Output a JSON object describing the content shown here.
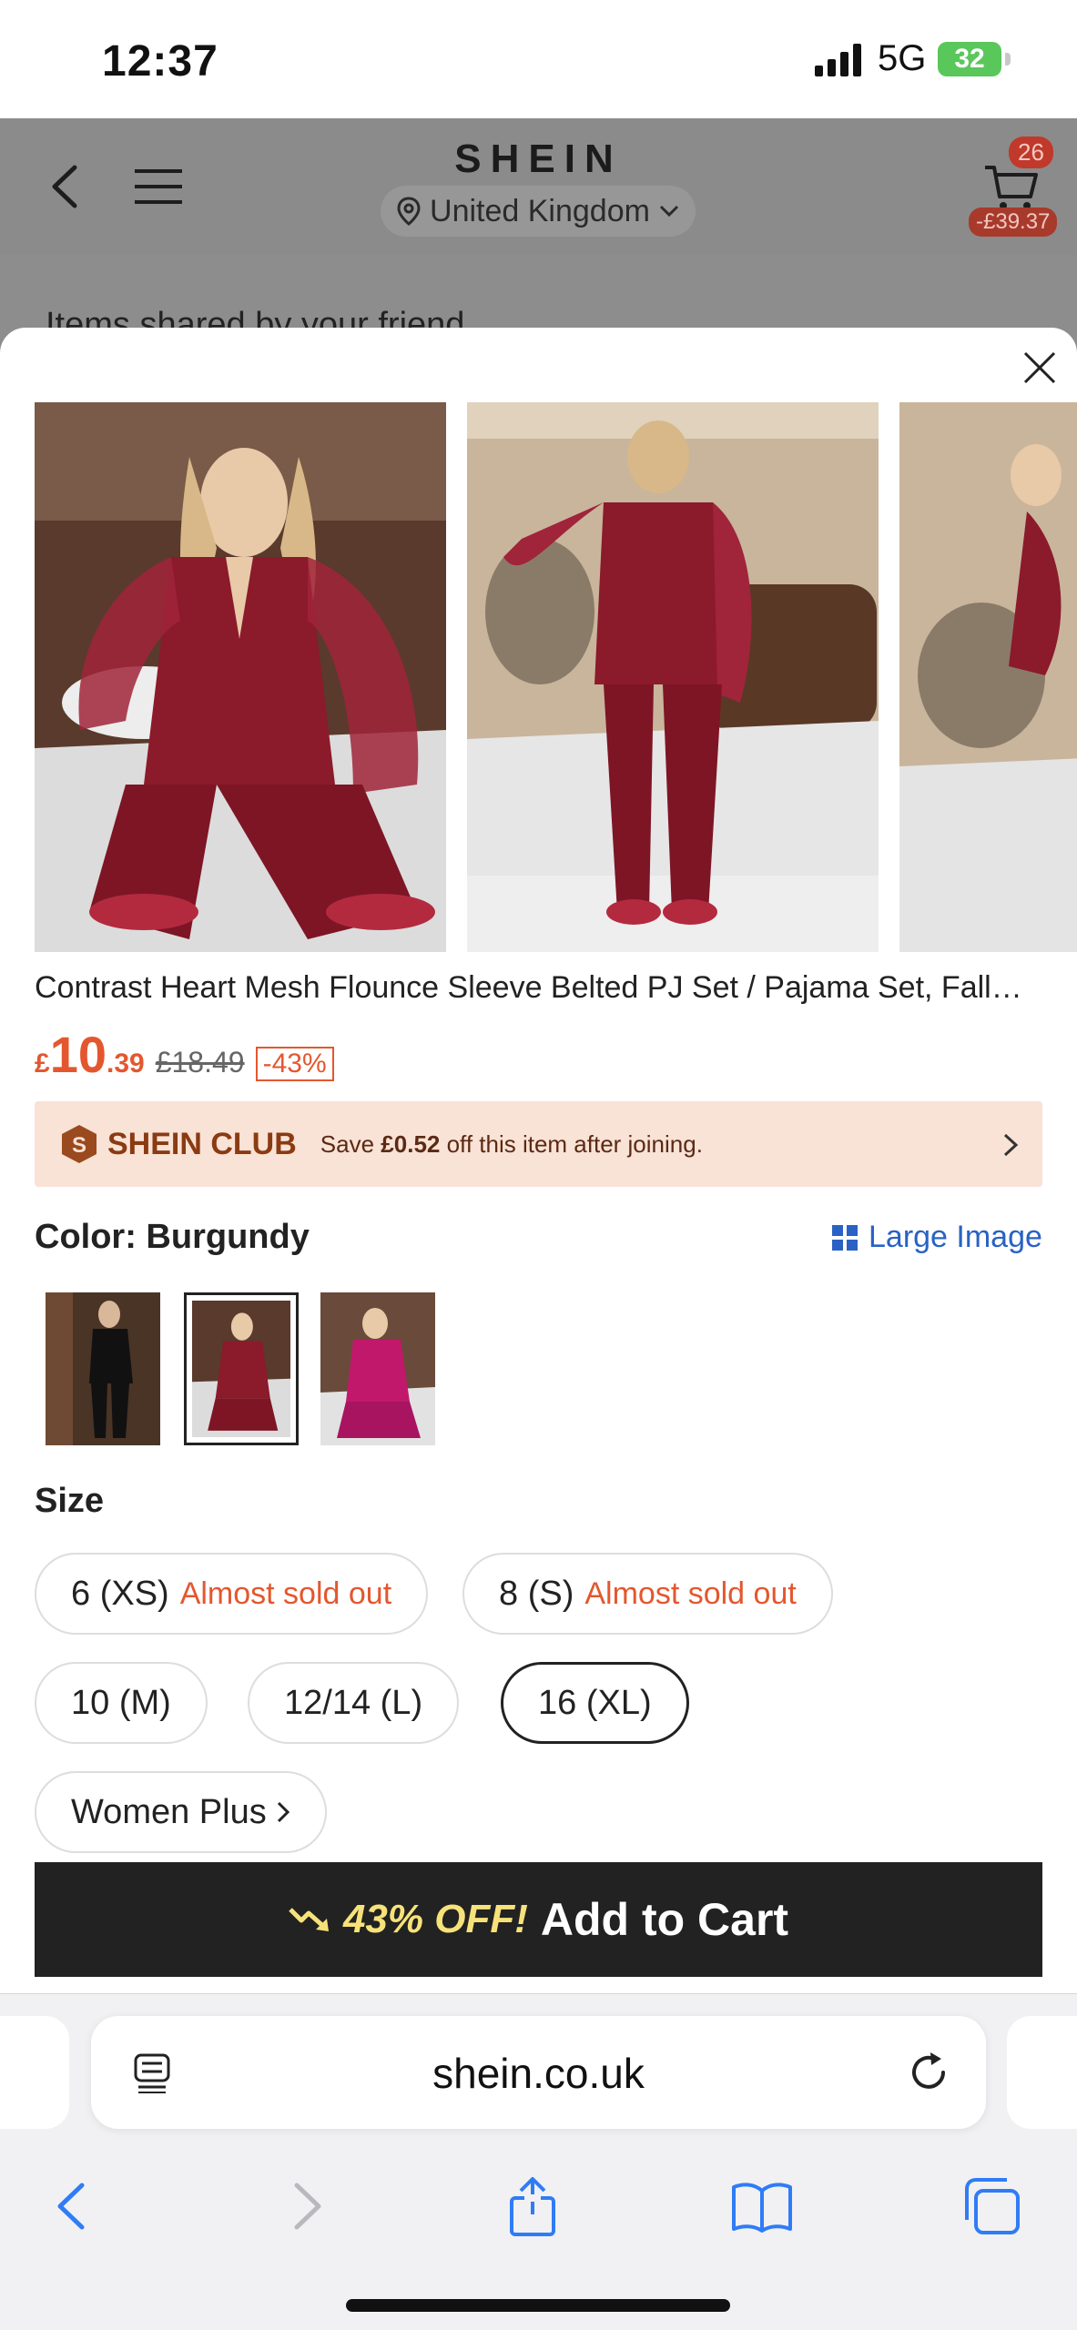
{
  "status_bar": {
    "time": "12:37",
    "network": "5G",
    "battery": "32"
  },
  "site_header": {
    "logo": "SHEIN",
    "region": "United Kingdom",
    "cart_count": "26",
    "cart_total": "-£39.37"
  },
  "background_text": "Items shared by your friend",
  "product": {
    "title": "Contrast Heart Mesh Flounce Sleeve Belted PJ Set / Pajama Set, Fall…",
    "price_currency": "£",
    "price_main": "10",
    "price_decimal": ".39",
    "original_price": "£18.49",
    "discount": "-43%"
  },
  "club": {
    "name": "SHEIN CLUB",
    "save_prefix": "Save ",
    "save_amount": "£0.52",
    "save_suffix": " off this item after joining."
  },
  "color": {
    "label": "Color: Burgundy",
    "large_image": "Large Image",
    "swatches": [
      "Black",
      "Burgundy",
      "Hot Pink"
    ],
    "selected": "Burgundy"
  },
  "size": {
    "label": "Size",
    "options": [
      {
        "label": "6 (XS)",
        "note": "Almost sold out"
      },
      {
        "label": "8 (S)",
        "note": "Almost sold out"
      },
      {
        "label": "10 (M)",
        "note": ""
      },
      {
        "label": "12/14 (L)",
        "note": ""
      },
      {
        "label": "16 (XL)",
        "note": ""
      }
    ],
    "selected": "16 (XL)",
    "women_plus": "Women Plus"
  },
  "cart_button": {
    "discount": "43% OFF!",
    "label": "Add to Cart"
  },
  "browser": {
    "url": "shein.co.uk"
  },
  "colors": {
    "accent": "#e4572e",
    "link": "#2962c4",
    "burgundy": "#8b1a2b",
    "club_bg": "#f9e2d6"
  }
}
